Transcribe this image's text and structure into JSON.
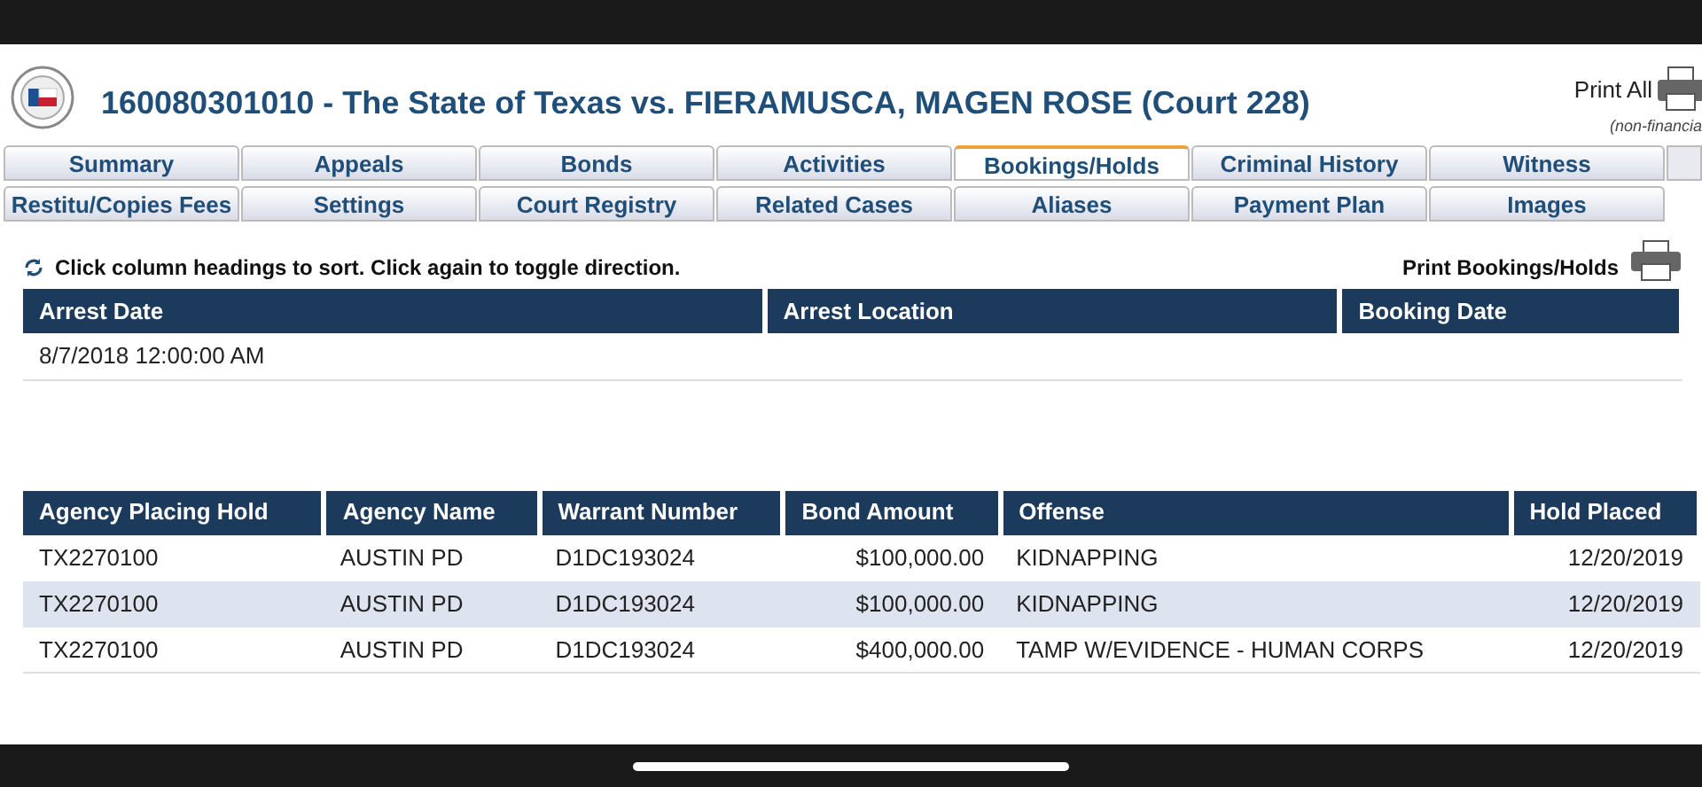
{
  "header": {
    "title": "160080301010 - The State of Texas vs. FIERAMUSCA, MAGEN ROSE (Court 228)",
    "print_all": "Print All",
    "print_note": "(non-financia"
  },
  "tabs": [
    [
      {
        "label": "Summary",
        "selected": false
      },
      {
        "label": "Appeals",
        "selected": false
      },
      {
        "label": "Bonds",
        "selected": false
      },
      {
        "label": "Activities",
        "selected": false
      },
      {
        "label": "Bookings/Holds",
        "selected": true
      },
      {
        "label": "Criminal History",
        "selected": false
      },
      {
        "label": "Witness",
        "selected": false
      }
    ],
    [
      {
        "label": "Restitu/Copies Fees",
        "selected": false
      },
      {
        "label": "Settings",
        "selected": false
      },
      {
        "label": "Court Registry",
        "selected": false
      },
      {
        "label": "Related Cases",
        "selected": false
      },
      {
        "label": "Aliases",
        "selected": false
      },
      {
        "label": "Payment Plan",
        "selected": false
      },
      {
        "label": "Images",
        "selected": false
      }
    ]
  ],
  "sort_hint": "Click column headings to sort. Click again to toggle direction.",
  "print_bookings": "Print Bookings/Holds",
  "bookings": {
    "columns": [
      "Arrest Date",
      "Arrest Location",
      "Booking Date"
    ],
    "rows": [
      [
        "8/7/2018 12:00:00 AM",
        "",
        ""
      ]
    ]
  },
  "holds": {
    "columns": [
      "Agency Placing Hold",
      "Agency Name",
      "Warrant Number",
      "Bond Amount",
      "Offense",
      "Hold Placed"
    ],
    "rows": [
      [
        "TX2270100",
        "AUSTIN PD",
        "D1DC193024",
        "$100,000.00",
        "KIDNAPPING",
        "12/20/2019"
      ],
      [
        "TX2270100",
        "AUSTIN PD",
        "D1DC193024",
        "$100,000.00",
        "KIDNAPPING",
        "12/20/2019"
      ],
      [
        "TX2270100",
        "AUSTIN PD",
        "D1DC193024",
        "$400,000.00",
        "TAMP W/EVIDENCE - HUMAN CORPS",
        "12/20/2019"
      ]
    ]
  }
}
